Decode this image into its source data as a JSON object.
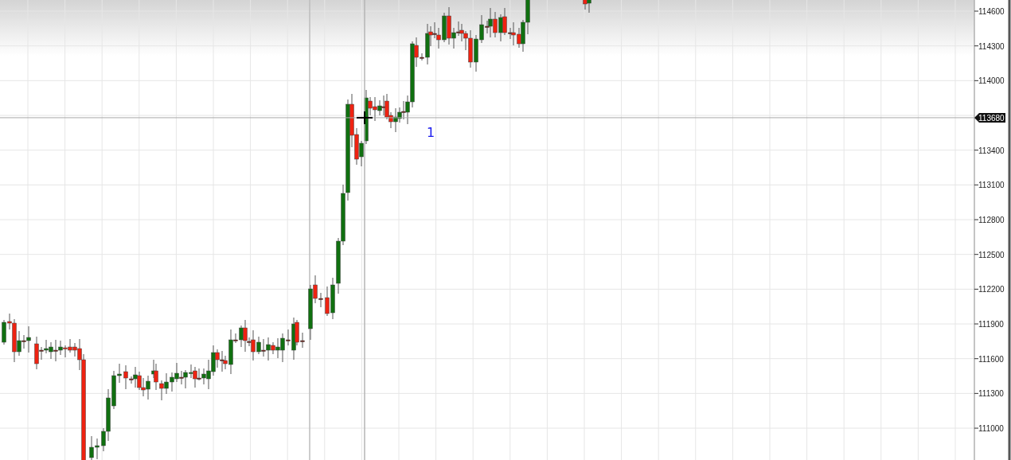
{
  "chart": {
    "price_axis": {
      "labels": [
        "114600",
        "114300",
        "114000",
        "113400",
        "113100",
        "112800",
        "112500",
        "112200",
        "111900",
        "111600",
        "111300",
        "111000"
      ]
    },
    "crosshair": {
      "price": "113680"
    },
    "annotation": "1"
  }
}
